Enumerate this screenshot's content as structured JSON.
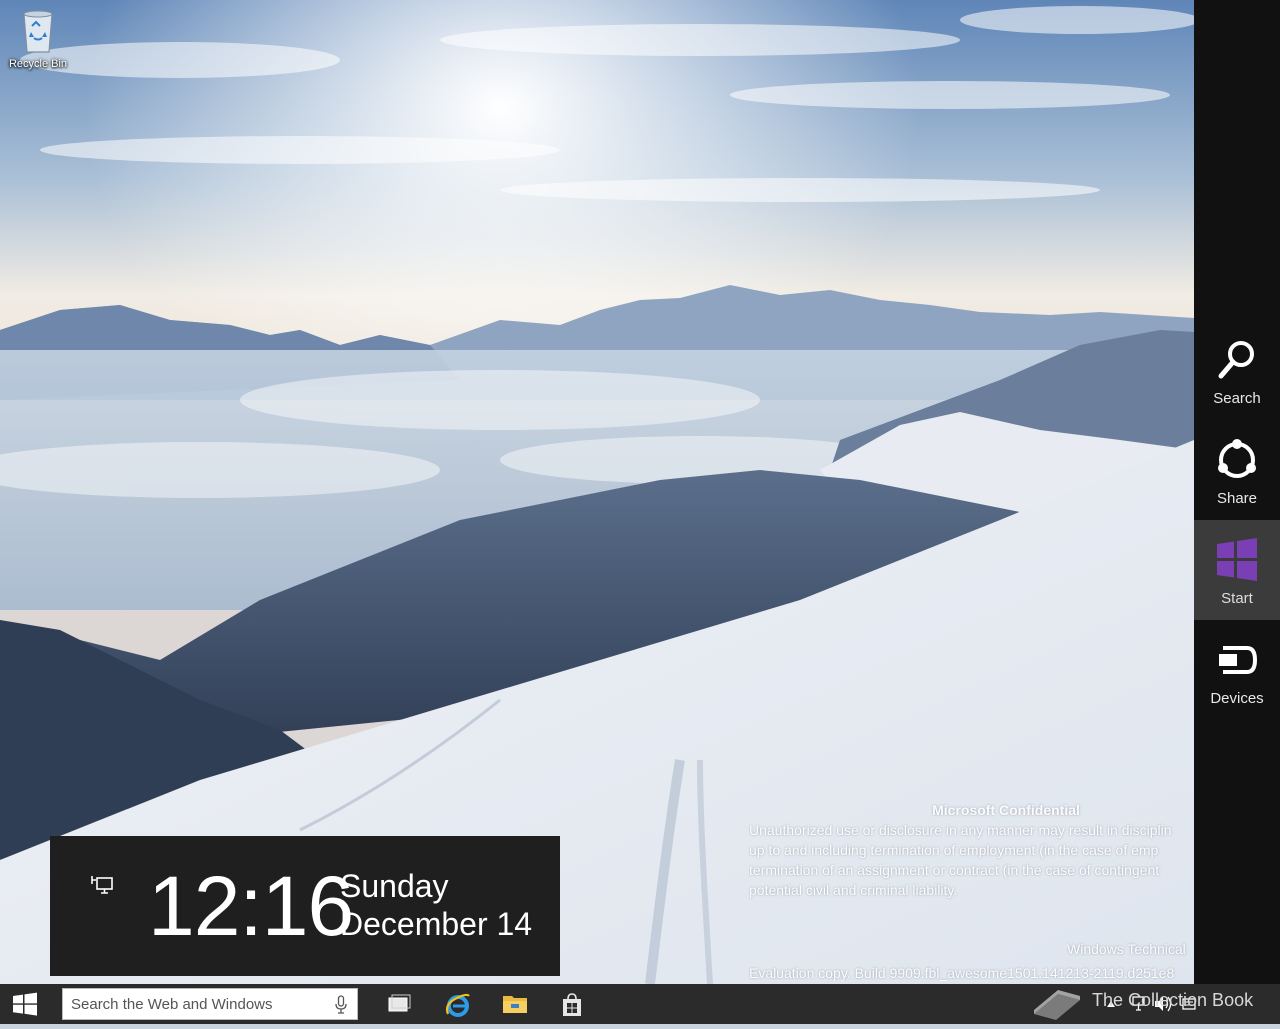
{
  "desktop": {
    "icons": [
      {
        "label": "Recycle Bin",
        "icon": "recycle-bin-icon"
      }
    ]
  },
  "watermark": {
    "title": "Microsoft Confidential",
    "lines": [
      "Unauthorized use or disclosure in any manner may result in disciplin",
      "up to and including termination of employment (in the case of emp",
      "termination of an assignment or contract (in the case of contingent",
      "potential civil and criminal liability."
    ],
    "build_line_1": "Windows Technical",
    "build_line_2": "Evaluation copy. Build 9909.fbl_awesome1501.141213-2119.d251e8"
  },
  "clock": {
    "time": "12:16",
    "day": "Sunday",
    "date": "December 14",
    "icon": "network-icon"
  },
  "charms": [
    {
      "label": "Search",
      "icon": "search-icon"
    },
    {
      "label": "Share",
      "icon": "share-icon"
    },
    {
      "label": "Start",
      "icon": "windows-logo-icon",
      "active": true,
      "accent": "#7b3fb5"
    },
    {
      "label": "Devices",
      "icon": "devices-icon"
    }
  ],
  "taskbar": {
    "search_placeholder": "Search the Web and Windows",
    "apps": [
      {
        "name": "task-view",
        "icon": "task-view-icon"
      },
      {
        "name": "internet-explorer",
        "icon": "ie-icon"
      },
      {
        "name": "file-explorer",
        "icon": "folder-icon"
      },
      {
        "name": "store",
        "icon": "store-icon"
      }
    ],
    "tray_icons": [
      "chevron-up-icon",
      "network-icon",
      "volume-icon",
      "action-center-icon"
    ]
  },
  "branding": {
    "text": "The Collection Book",
    "icon": "book-icon"
  },
  "colors": {
    "charms_bg": "#111111",
    "taskbar_bg": "#2b2b2b",
    "clock_bg": "#1f1f1f",
    "start_accent": "#7b3fb5"
  }
}
